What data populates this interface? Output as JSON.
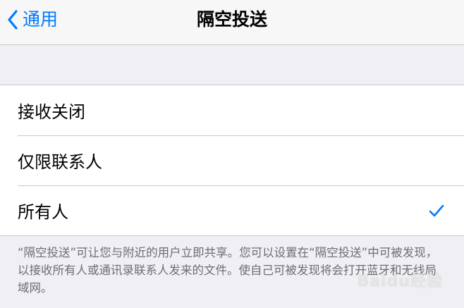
{
  "navbar": {
    "back_label": "通用",
    "title": "隔空投送"
  },
  "options": [
    {
      "label": "接收关闭",
      "selected": false
    },
    {
      "label": "仅限联系人",
      "selected": false
    },
    {
      "label": "所有人",
      "selected": true
    }
  ],
  "footer_text": "“隔空投送”可让您与附近的用户立即共享。您可以设置在“隔空投送”中可被发现，以接收所有人或通讯录联系人发来的文件。使自己可被发现将会打开蓝牙和无线局域网。",
  "watermark": "Baidu经验",
  "colors": {
    "accent": "#007aff",
    "background": "#efeff4",
    "footer_text": "#6d6d72",
    "separator": "#c8c7cc"
  },
  "icons": {
    "back": "chevron-left-icon",
    "selected": "checkmark-icon"
  }
}
